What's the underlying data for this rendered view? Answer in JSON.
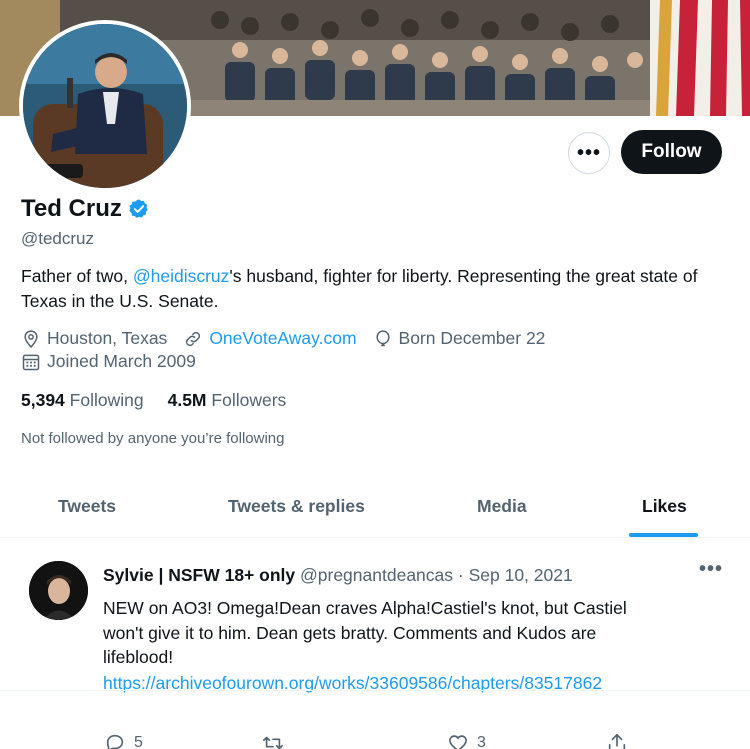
{
  "profile": {
    "name": "Ted Cruz",
    "handle": "@tedcruz",
    "bio_before": "Father of two, ",
    "bio_mention": "@heidiscruz",
    "bio_after": "'s husband, fighter for liberty. Representing the great state of Texas in the U.S. Senate.",
    "location": "Houston, Texas",
    "website": "OneVoteAway.com",
    "birthday": "Born December 22",
    "joined": "Joined March 2009",
    "following_count": "5,394",
    "following_label": "Following",
    "followers_count": "4.5M",
    "followers_label": "Followers",
    "not_followed": "Not followed by anyone you’re following"
  },
  "buttons": {
    "more_label": "•••",
    "follow_label": "Follow"
  },
  "tabs": [
    {
      "label": "Tweets"
    },
    {
      "label": "Tweets & replies"
    },
    {
      "label": "Media"
    },
    {
      "label": "Likes"
    }
  ],
  "tweet": {
    "author_name": "Sylvie | NSFW 18+ only",
    "author_handle": "@pregnantdeancas",
    "separator": "·",
    "date": "Sep 10, 2021",
    "more_label": "•••",
    "text": "NEW on AO3! Omega!Dean craves Alpha!Castiel's knot, but Castiel won't give it to him. Dean gets bratty. Comments and Kudos are lifeblood!",
    "link": "https://archiveofourown.org/works/33609586/chapters/83517862",
    "reply_count": "5",
    "like_count": "3"
  },
  "icons": {
    "verified": "verified-badge-icon",
    "location": "location-pin-icon",
    "website": "link-icon",
    "birthday": "balloon-icon",
    "joined": "calendar-icon",
    "reply": "reply-icon",
    "retweet": "retweet-icon",
    "like": "heart-icon",
    "share": "share-icon"
  },
  "colors": {
    "accent": "#1d9bf0",
    "text": "#0f1419",
    "secondary": "#536471",
    "follow_button": "#0f1419"
  }
}
